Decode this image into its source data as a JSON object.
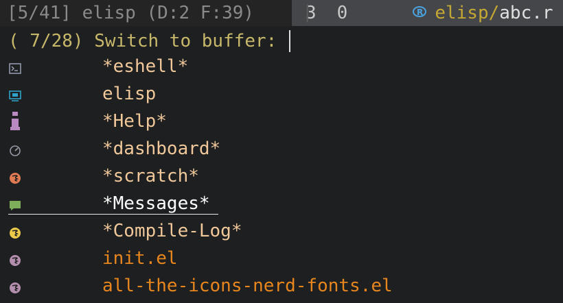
{
  "header": {
    "status": "[5/41] elisp (D:2 F:39)",
    "separator": "|",
    "num1": "3",
    "num2": "0",
    "dir": "elisp/",
    "file": "abc.r"
  },
  "prompt": {
    "text": "( 7/28) Switch to buffer: "
  },
  "buffers": [
    {
      "name": "*eshell*",
      "icon": "terminal-icon"
    },
    {
      "name": "elisp",
      "icon": "folder-icon"
    },
    {
      "name": "*Help*",
      "icon": "info-icon"
    },
    {
      "name": "*dashboard*",
      "icon": "dashboard-icon"
    },
    {
      "name": "*scratch*",
      "icon": "emacs-icon"
    },
    {
      "name": "*Messages*",
      "icon": "message-icon"
    },
    {
      "name": "*Compile-Log*",
      "icon": "emacs-icon"
    },
    {
      "name": "init.el",
      "icon": "emacs-icon"
    },
    {
      "name": "all-the-icons-nerd-fonts.el",
      "icon": "emacs-icon"
    }
  ],
  "colors": {
    "prompt": "#c8b86a",
    "buffer": "#f0c89a",
    "file": "#e8861e",
    "dir": "#c5a833"
  }
}
